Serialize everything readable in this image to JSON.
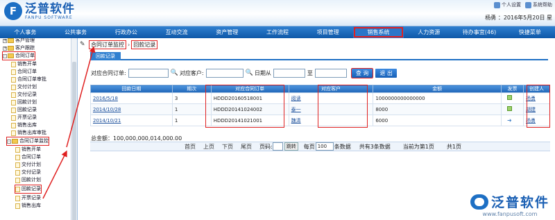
{
  "header": {
    "logo_cn": "泛普软件",
    "logo_en": "FANPU SOFTWARE",
    "tools": [
      "个人设置",
      "系统帮助"
    ],
    "user_line": "杨勇 ：2016年5月20日 星"
  },
  "nav": [
    "个人事务",
    "公共事务",
    "行政办公",
    "互动交流",
    "资产管理",
    "工作流程",
    "项目管理",
    "销售系统",
    "人力资源",
    "待办事宜(46)",
    "快捷菜单"
  ],
  "nav_active": "销售系统",
  "sidebar": {
    "items": [
      "客户管理",
      "客户跟踪",
      "合同订单",
      "销售开单",
      "合同订单",
      "合同订单审批",
      "交付计划",
      "交付记录",
      "回款计划",
      "回款记录",
      "开票记录",
      "销售出库",
      "销售出库审批",
      "合同订单监控",
      "销售开单",
      "合同订单",
      "交付计划",
      "交付记录",
      "回款计划",
      "回款记录",
      "开票记录",
      "销售出库"
    ]
  },
  "breadcrumb": [
    "合同订单监控",
    "回款记录"
  ],
  "tab": "回款记录",
  "search": {
    "order_label": "对应合同订单:",
    "customer_label": "对应客户:",
    "date_label": "日期从",
    "to_label": "至",
    "query_button": "查 询",
    "exit_button": "退 出"
  },
  "table": {
    "headers": [
      "回款日期",
      "期次",
      "对应合同订单",
      "对应客户",
      "金额",
      "发票",
      "创建人"
    ],
    "rows": [
      {
        "date": "2016/5/18",
        "period": "3",
        "order": "HDDD20160518001",
        "customer": "阅读",
        "amount": "1000000000000000",
        "invoice": "check",
        "creator": "杨勇"
      },
      {
        "date": "2014/10/28",
        "period": "1",
        "order": "HDDD20141024002",
        "customer": "泰一",
        "amount": "8000",
        "invoice": "check",
        "creator": "胡建"
      },
      {
        "date": "2014/10/21",
        "period": "1",
        "order": "HDDD20141021001",
        "customer": "魏清",
        "amount": "6000",
        "invoice": "arrow",
        "creator": "杨勇"
      }
    ]
  },
  "total": "总金额：100,000,000,014,000.00",
  "pager": {
    "first": "首页",
    "prev": "上页",
    "next": "下页",
    "last": "尾页",
    "page_label": "页码:",
    "jump": "跳转",
    "per_page_label": "每页",
    "per_page": "100",
    "per_page_suffix": "条数据",
    "count_text": "共有3条数据",
    "current": "当前为第1页",
    "total_pages": "共1页"
  },
  "brand": {
    "cn": "泛普软件",
    "url": "www.fanpusoft.com"
  },
  "colors": {
    "nav": "#1565b8",
    "highlight": "#e02020",
    "header_bg": "#e8f2fb"
  }
}
